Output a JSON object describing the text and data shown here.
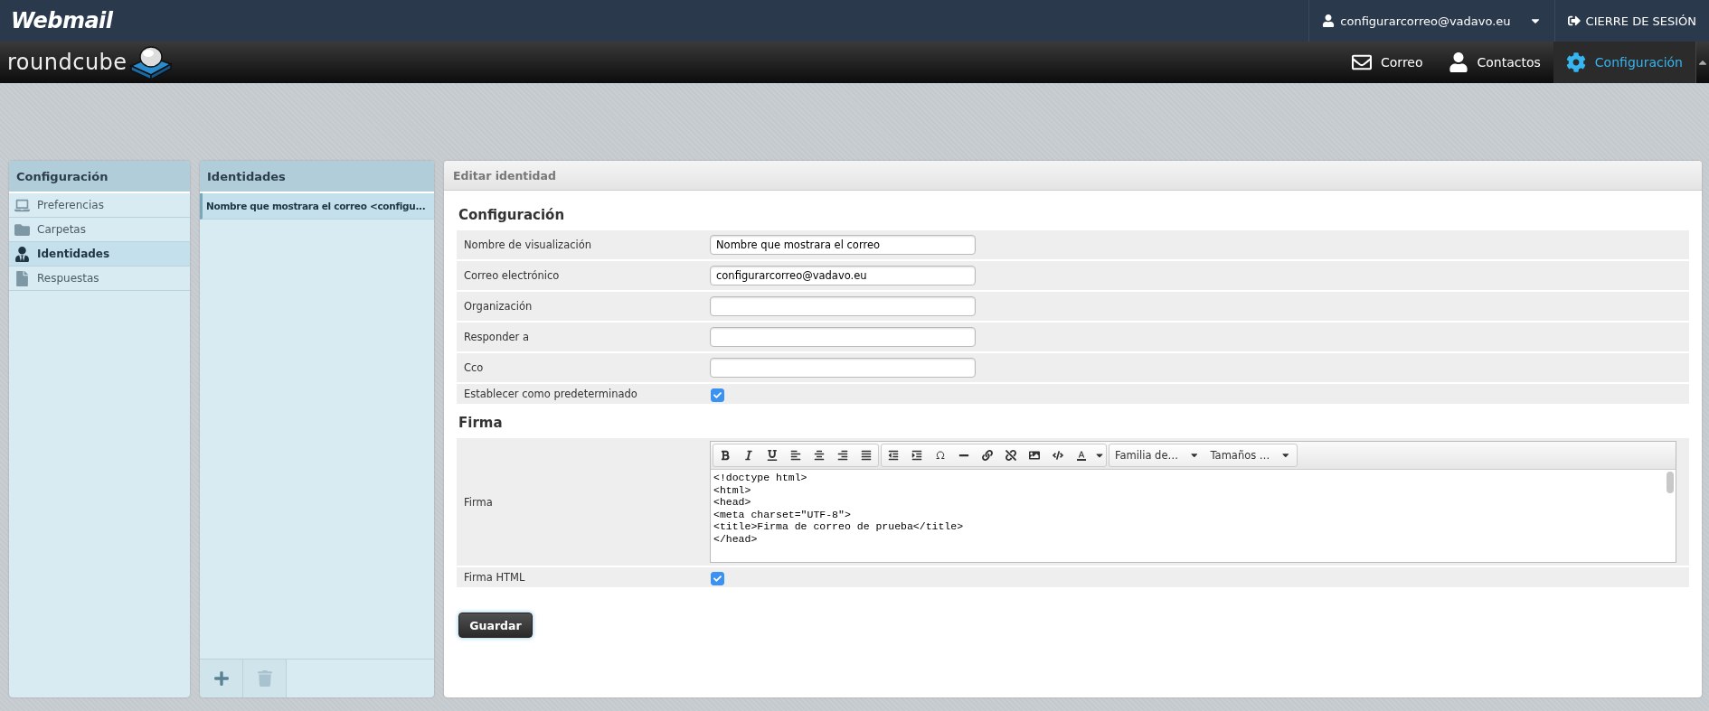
{
  "header": {
    "logo": "Webmail",
    "user": "configurarcorreo@vadavo.eu",
    "logout": "CIERRE DE SESIÓN"
  },
  "brand": "roundcube",
  "nav": [
    {
      "label": "Correo",
      "selected": false
    },
    {
      "label": "Contactos",
      "selected": false
    },
    {
      "label": "Configuración",
      "selected": true
    }
  ],
  "settings_panel": {
    "title": "Configuración",
    "items": [
      {
        "label": "Preferencias",
        "selected": false
      },
      {
        "label": "Carpetas",
        "selected": false
      },
      {
        "label": "Identidades",
        "selected": true
      },
      {
        "label": "Respuestas",
        "selected": false
      }
    ]
  },
  "identities_panel": {
    "title": "Identidades",
    "items": [
      {
        "label": "Nombre que mostrara el correo <configu...",
        "selected": true
      }
    ]
  },
  "edit_panel": {
    "title": "Editar identidad",
    "sections": [
      {
        "title": "Configuración",
        "fields": [
          {
            "kind": "text",
            "label": "Nombre de visualización",
            "value": "Nombre que mostrara el correo"
          },
          {
            "kind": "text",
            "label": "Correo electrónico",
            "value": "configurarcorreo@vadavo.eu"
          },
          {
            "kind": "text",
            "label": "Organización"
          },
          {
            "kind": "text",
            "label": "Responder a"
          },
          {
            "kind": "text",
            "label": "Cco"
          },
          {
            "kind": "checkbox",
            "label": "Establecer como predeterminado",
            "checked": true
          }
        ]
      },
      {
        "title": "Firma",
        "fields": [
          {
            "kind": "editor",
            "label": "Firma",
            "toolbar_menus": [
              "Familia de…",
              "Tamaños …"
            ],
            "lines": [
              "<!doctype html>",
              "<html>",
              "<head>",
              "<meta charset=\"UTF-8\">",
              "<title>Firma de correo de prueba</title>",
              "</head>"
            ]
          },
          {
            "kind": "checkbox",
            "label": "Firma HTML",
            "checked": true
          }
        ]
      }
    ],
    "save_button": "Guardar"
  }
}
